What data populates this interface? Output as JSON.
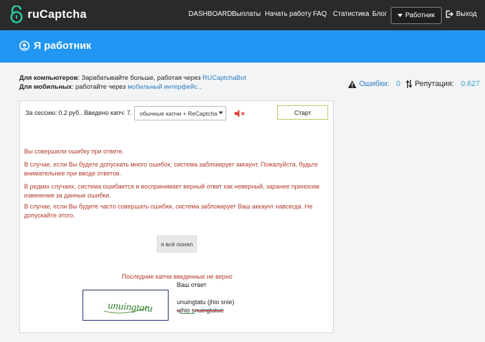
{
  "header": {
    "logo_text": "ruCaptcha",
    "nav": [
      "DASHBOARD",
      "Выплаты",
      "Начать работу",
      "FAQ",
      "Статистика",
      "Блог"
    ],
    "worker_button": "Работник",
    "exit_label": "Выход"
  },
  "banner": {
    "title": "Я работник"
  },
  "info": {
    "computers_label": "Для компьютеров",
    "computers_text": ": Зарабатывайте больше, работая через ",
    "computers_link": "RUCaptchaBot",
    "mobile_label": "Для мобильных",
    "mobile_text": ": работайте через ",
    "mobile_link": "мобильный интерфейс",
    "mobile_tail": " ."
  },
  "stats": {
    "errors_label": "Ошибки:",
    "errors_value": "0",
    "reputation_label": "Репутация:",
    "reputation_value": "0.627"
  },
  "panel": {
    "session_text": "За сессию: 0.2 руб.. Введено капч: 7.",
    "select_value": "обычные капчи + ReCaptcha",
    "start_button": "Старт",
    "errors": [
      "Вы совершили ошибку при ответе.",
      "В случае, если Вы будете допускать много ошибок, система заблокирует аккаунт. Пожалуйста, будьте внимательнее при вводе ответов.",
      "В редких случаях, система ошибается и воспринимает верный ответ как неверный, заранее приносим извинения за данные ошибки.",
      "В случае, если Вы будете часто совершать ошибки, система заблокирует Ваш аккаунт навсегда. Не допускайте этого."
    ],
    "ack_button": "я всё понял",
    "last_title": "Последние капчи введенные не верно",
    "your_answer_label": "Ваш ответ",
    "captcha_image_text": "unuingtatu",
    "answer_line1": "unuingtatu (jhio snie)",
    "answer_line2_a": "u",
    "answer_line2_b": "jhio",
    "answer_line2_c": " s",
    "answer_line2_d": "nuingtatue"
  }
}
